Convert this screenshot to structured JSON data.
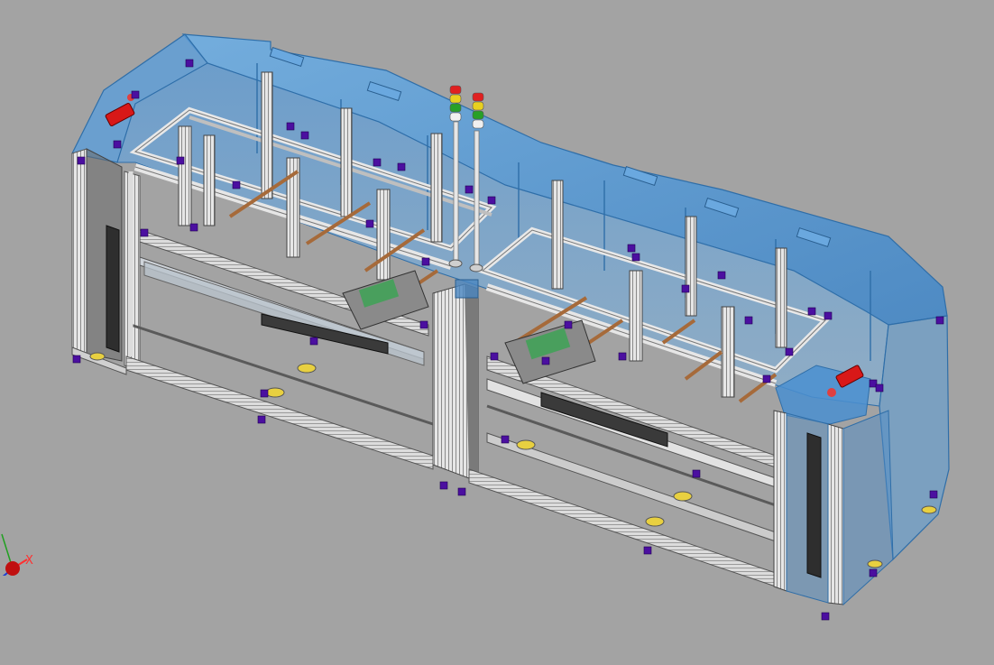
{
  "viewport": {
    "background": "#a3a3a3",
    "enclosure_color": "#4f95d6",
    "frame_color": "#d9d9d9",
    "dark_frame_color": "#3a3a3a",
    "fastener_color": "#4b0fa0",
    "rail_color": "#a66a3a"
  },
  "model": {
    "signal_towers": [
      {
        "lights": [
          "#e02020",
          "#e8d020",
          "#28a028",
          "#f0f0f0"
        ]
      },
      {
        "lights": [
          "#e02020",
          "#e8d020",
          "#28a028",
          "#f0f0f0"
        ]
      }
    ],
    "estop_color": "#d81818"
  },
  "triad": {
    "x_label": "X",
    "x_color": "#ff3030",
    "origin_color": "#c01010"
  }
}
